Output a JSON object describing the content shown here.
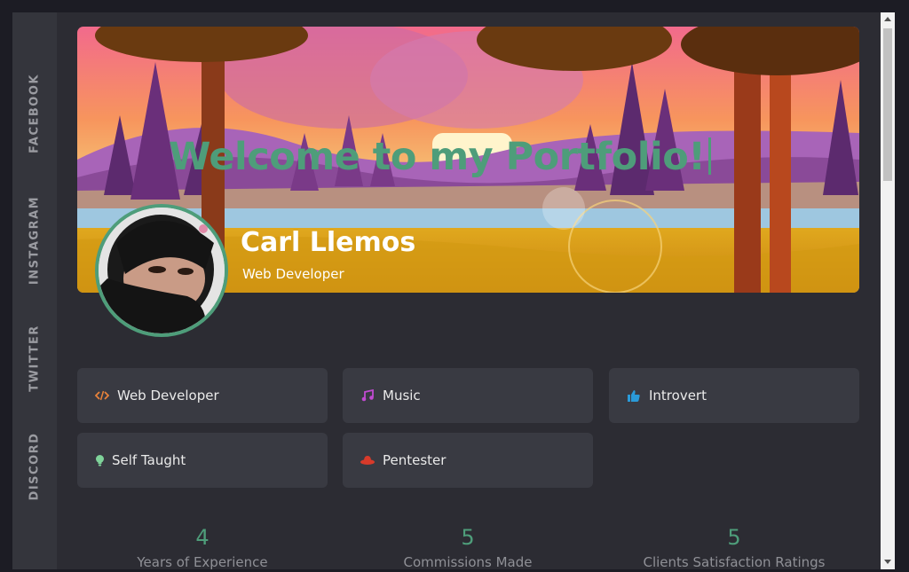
{
  "sidebar": {
    "links": [
      {
        "label": "FACEBOOK"
      },
      {
        "label": "INSTAGRAM"
      },
      {
        "label": "TWITTER"
      },
      {
        "label": "DISCORD"
      }
    ]
  },
  "hero": {
    "welcome": "Welcome to my Portfolio!",
    "name": "Carl Llemos",
    "role": "Web Developer"
  },
  "traits": [
    {
      "label": "Web Developer",
      "icon": "code-icon",
      "color": "#e8823a"
    },
    {
      "label": "Music",
      "icon": "music-icon",
      "color": "#c04ad0"
    },
    {
      "label": "Introvert",
      "icon": "thumbs-up-icon",
      "color": "#2a9ad8"
    },
    {
      "label": "Self Taught",
      "icon": "lightbulb-icon",
      "color": "#7fd39a"
    },
    {
      "label": "Pentester",
      "icon": "red-hat-icon",
      "color": "#d83a2a"
    }
  ],
  "stats": [
    {
      "number": "4",
      "label": "Years of Experience"
    },
    {
      "number": "5",
      "label": "Commissions Made"
    },
    {
      "number": "5",
      "label": "Clients Satisfaction Ratings"
    }
  ],
  "colors": {
    "accent": "#4e9d7a",
    "background": "#2c2c33",
    "card": "#393a42",
    "sidebar": "#34353c"
  }
}
